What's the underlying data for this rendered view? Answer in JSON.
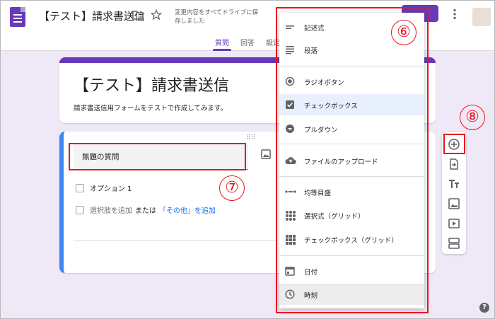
{
  "header": {
    "doc_title": "【テスト】請求書送信",
    "save_status": "変更内容をすべてドライブに保存しました",
    "tabs": [
      {
        "label": "質問"
      },
      {
        "label": "回答"
      },
      {
        "label": "設定"
      }
    ]
  },
  "form": {
    "title": "【テスト】請求書送信",
    "description": "請求書送信用フォームをテストで作成してみます。"
  },
  "question": {
    "title": "無題の質問",
    "option_1": "オプション 1",
    "add_option": "選択肢を追加",
    "or": "または",
    "add_other": "「その他」を追加"
  },
  "menu": {
    "items": [
      {
        "label": "記述式",
        "icon": "short-answer-icon"
      },
      {
        "label": "段落",
        "icon": "paragraph-icon"
      },
      {
        "label": "ラジオボタン",
        "icon": "radio-icon"
      },
      {
        "label": "チェックボックス",
        "icon": "checkbox-icon"
      },
      {
        "label": "プルダウン",
        "icon": "dropdown-icon"
      },
      {
        "label": "ファイルのアップロード",
        "icon": "cloud-upload-icon"
      },
      {
        "label": "均等目盛",
        "icon": "linear-scale-icon"
      },
      {
        "label": "選択式（グリッド）",
        "icon": "grid-icon"
      },
      {
        "label": "チェックボックス（グリッド）",
        "icon": "checkbox-grid-icon"
      },
      {
        "label": "日付",
        "icon": "calendar-icon"
      },
      {
        "label": "時刻",
        "icon": "clock-icon"
      }
    ]
  },
  "annotations": {
    "menu_number": "⑥",
    "question_number": "⑦",
    "add_number": "⑧"
  },
  "colors": {
    "accent": "#673ab7",
    "annotation": "#e8151d",
    "link": "#1a73e8",
    "question_border": "#4285f4"
  }
}
